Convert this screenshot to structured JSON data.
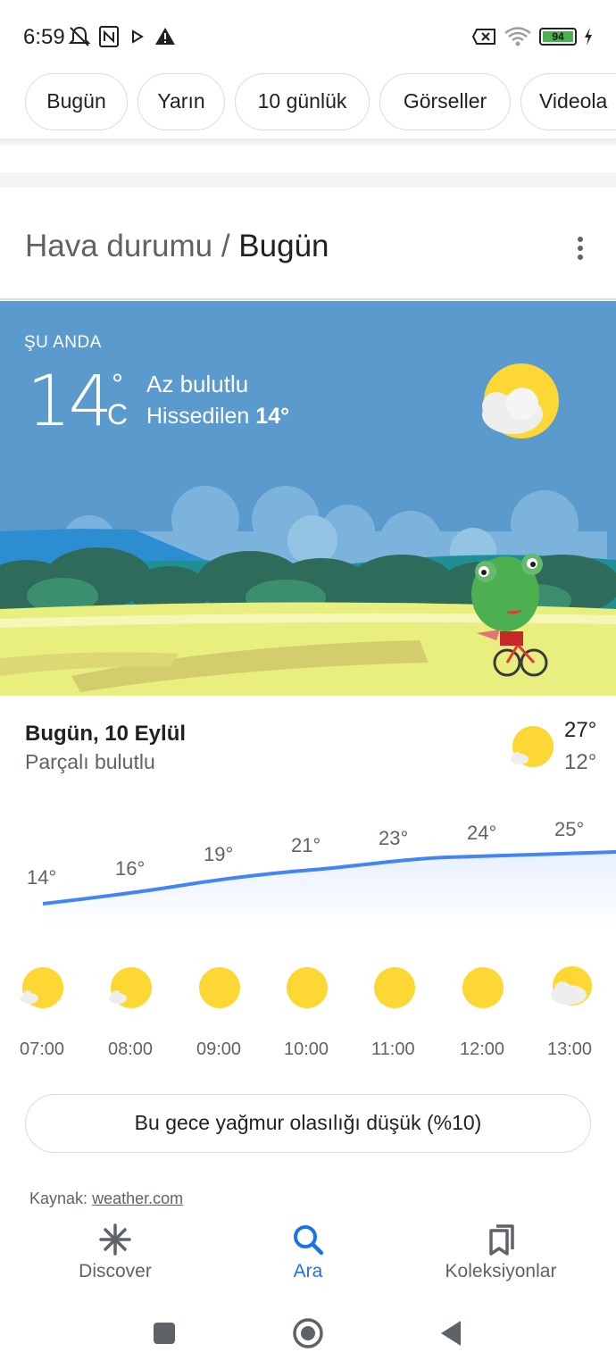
{
  "status_bar": {
    "time": "6:59",
    "battery": "94",
    "icons": [
      "bell-off-icon",
      "nfc-icon",
      "play-icon",
      "warning-icon",
      "sim-x-icon",
      "wifi-icon",
      "battery-icon",
      "charging-icon"
    ]
  },
  "chips": [
    "Bugün",
    "Yarın",
    "10 günlük",
    "Görseller",
    "Videola"
  ],
  "header": {
    "title_prefix": "Hava durumu /",
    "title_current": "Bugün"
  },
  "current": {
    "label": "ŞU ANDA",
    "temp": "14",
    "degree": "°",
    "unit": "C",
    "condition": "Az bulutlu",
    "feels_label": "Hissedilen",
    "feels_value": "14°"
  },
  "summary": {
    "date": "Bugün, 10 Eylül",
    "condition": "Parçalı bulutlu",
    "high": "27°",
    "low": "12°"
  },
  "hourly": [
    {
      "time": "07:00",
      "temp": "14°",
      "icon": "partly-sunny-icon"
    },
    {
      "time": "08:00",
      "temp": "16°",
      "icon": "partly-sunny-icon"
    },
    {
      "time": "09:00",
      "temp": "19°",
      "icon": "sunny-icon"
    },
    {
      "time": "10:00",
      "temp": "21°",
      "icon": "sunny-icon"
    },
    {
      "time": "11:00",
      "temp": "23°",
      "icon": "sunny-icon"
    },
    {
      "time": "12:00",
      "temp": "24°",
      "icon": "sunny-icon"
    },
    {
      "time": "13:00",
      "temp": "25°",
      "icon": "mostly-cloudy-icon"
    }
  ],
  "rain_chance": "Bu gece yağmur olasılığı düşük (%10)",
  "source": {
    "label": "Kaynak:",
    "link": "weather.com"
  },
  "bottom_nav": [
    {
      "label": "Discover",
      "icon": "asterisk-icon",
      "active": false
    },
    {
      "label": "Ara",
      "icon": "search-icon",
      "active": true
    },
    {
      "label": "Koleksiyonlar",
      "icon": "bookmarks-icon",
      "active": false
    }
  ],
  "colors": {
    "accent": "#1a73e8",
    "sky": "#5a9acd",
    "sun": "#fdd835",
    "grass": "#e5ec7a"
  }
}
